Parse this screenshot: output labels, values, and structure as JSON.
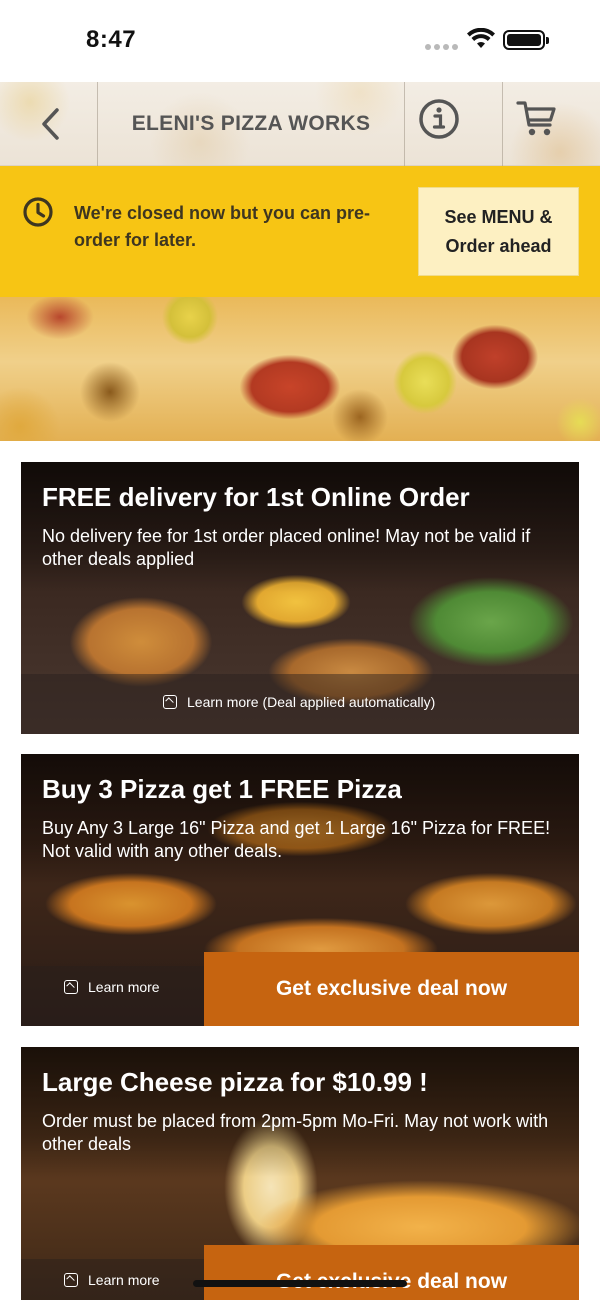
{
  "status_bar": {
    "time": "8:47"
  },
  "header": {
    "title": "ELENI'S PIZZA WORKS",
    "back_icon": "chevron-left-icon",
    "info_icon": "info-icon",
    "cart_icon": "cart-icon"
  },
  "closed_banner": {
    "message": "We're closed now but you can pre-order for later.",
    "button_label": "See MENU &\nOrder ahead",
    "icon": "clock-icon",
    "background_color": "#f7c514"
  },
  "deals": [
    {
      "title": "FREE delivery for 1st Online Order",
      "description": "No delivery fee for 1st order placed online! May not be valid if other deals applied",
      "learn_more": "Learn more (Deal applied automatically)"
    },
    {
      "title": "Buy 3 Pizza get 1 FREE Pizza",
      "description": "Buy Any 3 Large 16\" Pizza and get 1 Large 16\" Pizza for FREE! Not valid with any other deals.",
      "learn_more": "Learn more",
      "cta": "Get exclusive deal now"
    },
    {
      "title": "Large Cheese pizza for $10.99 !",
      "description": "Order must be placed from 2pm-5pm Mo-Fri. May not work with other deals",
      "learn_more": "Learn more",
      "cta": "Get exclusive deal now"
    }
  ],
  "colors": {
    "accent": "#c66410",
    "banner": "#f7c514",
    "banner_button": "#fdf0c2"
  }
}
